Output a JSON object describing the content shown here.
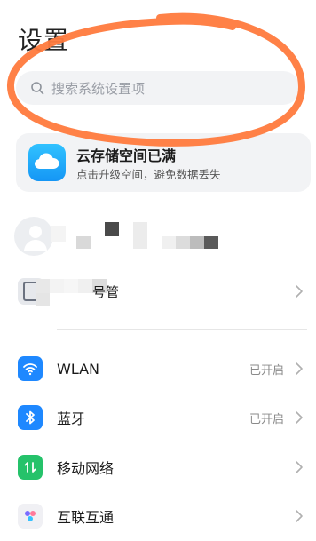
{
  "page": {
    "title": "设置"
  },
  "search": {
    "placeholder": "搜索系统设置项"
  },
  "storage_banner": {
    "title": "云存储空间已满",
    "subtitle": "点击升级空间，避免数据丢失"
  },
  "account_row": {
    "label_visible_fragment": "号管"
  },
  "settings_items": [
    {
      "label": "WLAN",
      "status": "已开启",
      "icon": "wifi-icon",
      "color": "#1e88ff"
    },
    {
      "label": "蓝牙",
      "status": "已开启",
      "icon": "bluetooth-icon",
      "color": "#1e88ff"
    },
    {
      "label": "移动网络",
      "status": "",
      "icon": "mobile-network-icon",
      "color": "#25c26a"
    },
    {
      "label": "互联互通",
      "status": "",
      "icon": "device-interconnect-icon",
      "color": "#f0f0f4"
    }
  ],
  "colors": {
    "annotation_ellipse": "#ff7a3d",
    "search_bg": "#f2f3f5",
    "cloud_blue": "#1596f5"
  }
}
